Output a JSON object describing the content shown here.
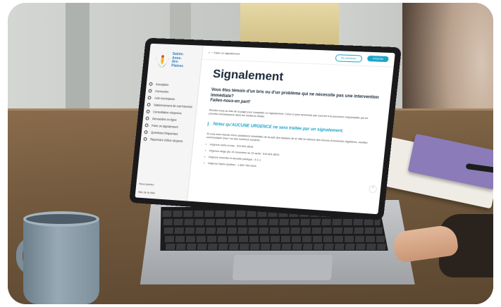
{
  "sidebar": {
    "logo_text": [
      "Sainte-",
      "Anne-",
      "des-",
      "Plaines"
    ],
    "items": [
      {
        "label": "Inscription",
        "icon": "user-icon"
      },
      {
        "label": "Connexion",
        "icon": "user-icon"
      },
      {
        "label": "Avis municipaux",
        "icon": "megaphone-icon"
      },
      {
        "label": "Stationnement de nuit hivernal",
        "icon": "parking-icon"
      },
      {
        "label": "Consultation citoyenne",
        "icon": "chat-icon"
      },
      {
        "label": "Demandes en ligne",
        "icon": "edit-icon"
      },
      {
        "label": "Faire un signalement",
        "icon": "flag-icon"
      },
      {
        "label": "Questions fréquentes",
        "icon": "help-icon"
      },
      {
        "label": "Répertoire d'élus citoyens",
        "icon": "list-icon"
      }
    ],
    "footer_1": "Nous joindre",
    "footer_2": "Site de la Ville"
  },
  "topbar": {
    "breadcrumb": "Faire un signalement",
    "btn_outline": "Se connecter",
    "btn_fill": "S'inscrire"
  },
  "content": {
    "title": "Signalement",
    "lead": "Vous êtes témoin d'un bris ou d'un problème qui ne nécessite pas une intervention immédiate?",
    "lead_em": "Faites-nous-en part!",
    "para": "Rendez-vous au bas de la page pour compléter un signalement. Celui-ci sera acheminé par courriel à la personne responsable qui en prendra connaissance dans les meilleurs délais.",
    "notice": "Notez qu'AUCUNE URGENCE ne sera traitée par un signalement.",
    "para2": "Si vous avez besoin d'une assistance immédiate de la part des équipes de la Ville en dehors des heures d'ouverture régulières, veuillez communiquer avec l'un des numéros suivants :",
    "list": [
      "Urgence voirie et eau : 514 801-8519",
      "Urgence neige (du 15 novembre au 15 avril) : 514 801-8519",
      "Urgence incendie et sécurité publique : 9-1-1",
      "Urgence Hydro-Québec : 1 800 790-2424"
    ]
  },
  "colors": {
    "accent": "#1ea5c9",
    "title": "#1b2a3a"
  }
}
